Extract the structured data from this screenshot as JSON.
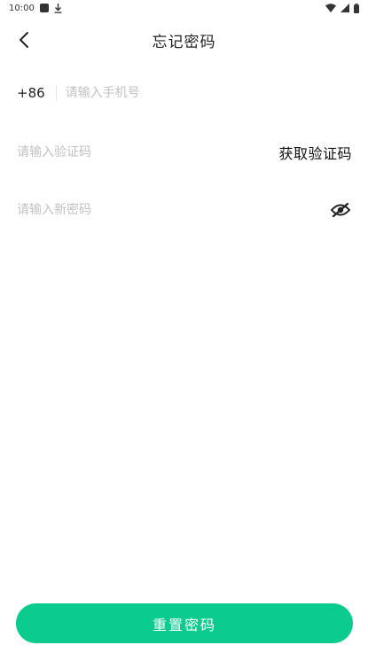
{
  "status_bar": {
    "time": "10:00",
    "icons": [
      "notification-square-icon",
      "download-icon",
      "wifi-icon",
      "signal-icon",
      "battery-icon"
    ]
  },
  "header": {
    "title": "忘记密码",
    "back_icon": "chevron-left-icon"
  },
  "form": {
    "country_code": "+86",
    "phone_placeholder": "请输入手机号",
    "code_placeholder": "请输入验证码",
    "get_code_label": "获取验证码",
    "password_placeholder": "请输入新密码",
    "password_toggle_icon": "eye-off-icon"
  },
  "actions": {
    "reset_label": "重置密码"
  },
  "colors": {
    "accent": "#0ccb8e",
    "text_primary": "#222222",
    "placeholder": "#c2c2c2"
  }
}
